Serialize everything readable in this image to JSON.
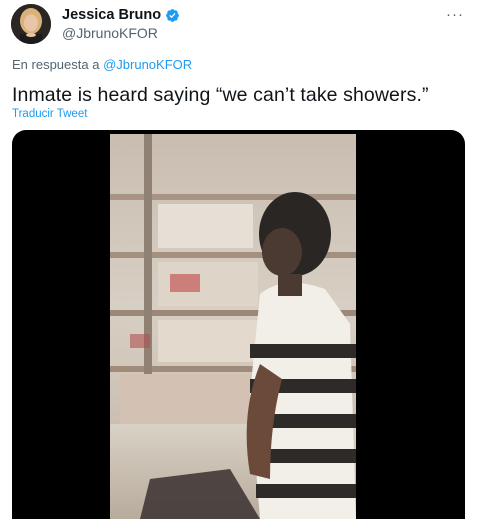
{
  "tweet": {
    "author_name": "Jessica Bruno",
    "author_handle": "@JbrunoKFOR",
    "reply_prefix": "En respuesta a",
    "reply_mention": "@JbrunoKFOR",
    "text": "Inmate is heard saying “we can’t take showers.”",
    "translate_label": "Traducir Tweet",
    "more_label": "···"
  },
  "icons": {
    "verified": "verified-badge-icon",
    "more": "more-options-icon"
  },
  "colors": {
    "accent": "#1d9bf0",
    "secondary_text": "#536471",
    "primary_text": "#0f1419"
  }
}
